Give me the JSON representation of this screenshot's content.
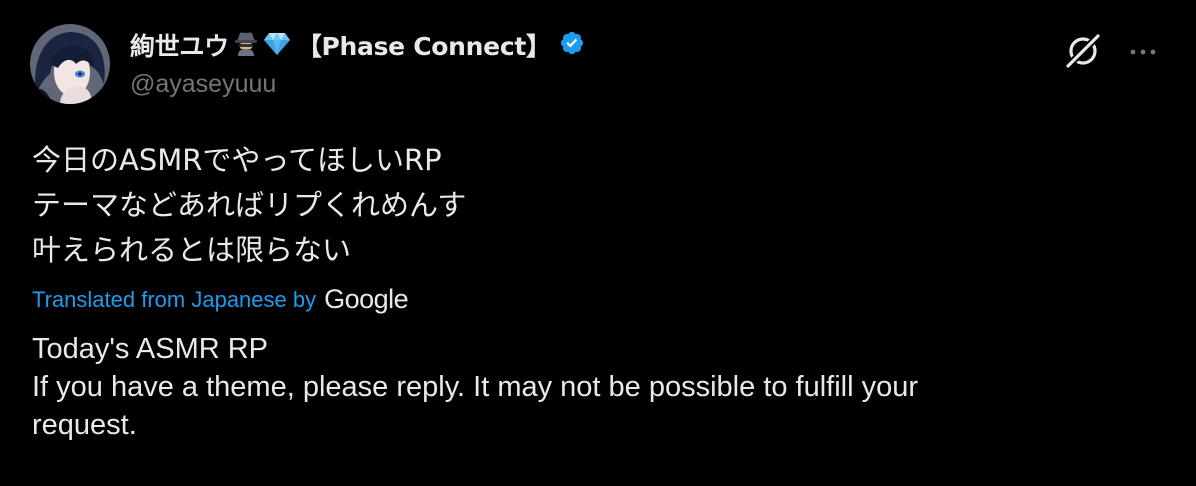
{
  "colors": {
    "background": "#000000",
    "text_primary": "#e7e9ea",
    "text_secondary": "#71767b",
    "link_blue": "#1d9bf0",
    "verified_blue": "#1d9bf0"
  },
  "author": {
    "display_name": "絢世ユウ",
    "emojis": [
      "detective-emoji",
      "gem-emoji"
    ],
    "name_suffix": "【Phase Connect】",
    "handle": "@ayaseyuuu",
    "verified": true
  },
  "header_actions": {
    "icons": [
      "grok-icon",
      "more-icon"
    ]
  },
  "tweet": {
    "text_lines": [
      "今日のASMRでやってほしいRP",
      "テーマなどあればリプくれめんす",
      "叶えられるとは限らない"
    ],
    "translation_label": "Translated from Japanese by",
    "translation_provider": "Google",
    "translation_lines": [
      "Today's ASMR RP",
      "If you have a theme, please reply. It may not be possible to fulfill your",
      "request."
    ]
  }
}
